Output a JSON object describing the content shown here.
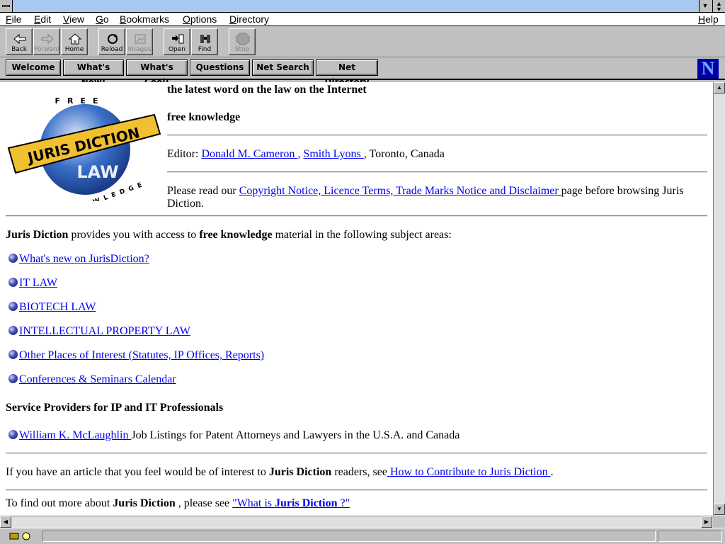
{
  "menu": [
    "File",
    "Edit",
    "View",
    "Go",
    "Bookmarks",
    "Options",
    "Directory",
    "Help"
  ],
  "menu_access_keys": [
    "F",
    "E",
    "V",
    "G",
    "B",
    "O",
    "D",
    "H"
  ],
  "toolbar": {
    "buttons": [
      {
        "label": "Back",
        "icon": "back-arrow-icon"
      },
      {
        "label": "Forward",
        "icon": "forward-arrow-icon",
        "disabled": true
      },
      {
        "label": "Home",
        "icon": "home-icon"
      },
      {
        "label": "Reload",
        "icon": "reload-icon"
      },
      {
        "label": "Images",
        "icon": "images-icon",
        "disabled": true
      },
      {
        "label": "Open",
        "icon": "open-icon"
      },
      {
        "label": "Find",
        "icon": "binoculars-icon"
      },
      {
        "label": "Stop",
        "icon": "stop-icon",
        "disabled": true
      }
    ]
  },
  "directory_buttons": [
    "Welcome",
    "What's New!",
    "What's Cool!",
    "Questions",
    "Net Search",
    "Net Directory"
  ],
  "logo_letter": "N",
  "page": {
    "logo": {
      "ring_top": "FREE",
      "ring_bottom": "KNOWLEDGE",
      "banner": "JURIS DICTION",
      "globe_text": "LAW"
    },
    "tagline": "the latest word on the law on the Internet",
    "subtag": "free knowledge",
    "editor_label": "Editor:",
    "editor_name": "Donald M. Cameron ",
    "editor_sep": ",",
    "editor_firm": "Smith Lyons ",
    "editor_location": ", Toronto, Canada",
    "notice_pre": "Please read our ",
    "notice_link": "Copyright Notice, Licence Terms, Trade Marks Notice and Disclaimer ",
    "notice_post": "page before browsing Juris",
    "notice_post2": "Diction.",
    "intro_bold": "Juris Diction",
    "intro_mid": " provides you with access to ",
    "intro_bold2": "free knowledge",
    "intro_end": " material in the following subject areas:",
    "subject_links": [
      " What's new on JurisDiction?",
      " IT LAW",
      " BIOTECH LAW",
      " INTELLECTUAL PROPERTY LAW",
      " Other Places of Interest (Statutes, IP Offices, Reports)",
      " Conferences & Seminars Calendar"
    ],
    "service_heading": "Service Providers for IP and IT Professionals",
    "service_link": " William K. McLaughlin ",
    "service_text": "Job Listings for Patent Attorneys and Lawyers in the U.S.A. and Canada",
    "contrib_pre": "If you have an article that you feel would be of interest to ",
    "contrib_bold": "Juris Diction",
    "contrib_mid": " readers, see",
    "contrib_link": " How to Contribute to Juris Diction ",
    "contrib_end": ".",
    "more_pre": "To find out more about ",
    "more_bold": "Juris Diction",
    "more_mid": " , please see ",
    "more_link_a": "\"What is ",
    "more_link_b": "Juris Diction",
    "more_link_c": " ?\""
  },
  "colors": {
    "link": "#0000ee",
    "titlebar": "#a8c8f0",
    "banner_gold": "#f0c030",
    "globe_blue": "#3a70c8"
  }
}
